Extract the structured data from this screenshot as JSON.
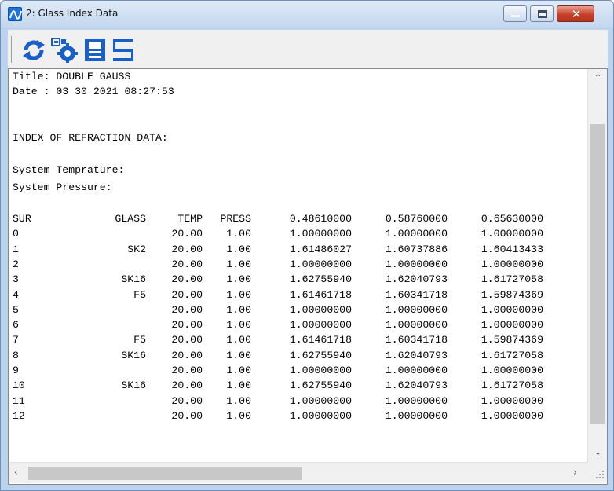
{
  "window": {
    "title": "2: Glass Index Data",
    "close_glyph": "✕"
  },
  "toolbar": {
    "buttons": [
      {
        "name": "refresh-icon"
      },
      {
        "name": "settings-icon"
      },
      {
        "name": "save-icon"
      },
      {
        "name": "print-icon"
      }
    ]
  },
  "report": {
    "title_line": "Title: DOUBLE GAUSS",
    "date_line": "Date : 03 30 2021 08:27:53",
    "section": "INDEX OF REFRACTION DATA:",
    "temperature_label": "System Temprature:",
    "pressure_label": "System Pressure:",
    "columns": [
      "SUR",
      "GLASS",
      "TEMP",
      "PRESS",
      "0.48610000",
      "0.58760000",
      "0.65630000"
    ],
    "rows": [
      [
        "0",
        "",
        "20.00",
        "1.00",
        "1.00000000",
        "1.00000000",
        "1.00000000"
      ],
      [
        "1",
        "SK2",
        "20.00",
        "1.00",
        "1.61486027",
        "1.60737886",
        "1.60413433"
      ],
      [
        "2",
        "",
        "20.00",
        "1.00",
        "1.00000000",
        "1.00000000",
        "1.00000000"
      ],
      [
        "3",
        "SK16",
        "20.00",
        "1.00",
        "1.62755940",
        "1.62040793",
        "1.61727058"
      ],
      [
        "4",
        "F5",
        "20.00",
        "1.00",
        "1.61461718",
        "1.60341718",
        "1.59874369"
      ],
      [
        "5",
        "",
        "20.00",
        "1.00",
        "1.00000000",
        "1.00000000",
        "1.00000000"
      ],
      [
        "6",
        "",
        "20.00",
        "1.00",
        "1.00000000",
        "1.00000000",
        "1.00000000"
      ],
      [
        "7",
        "F5",
        "20.00",
        "1.00",
        "1.61461718",
        "1.60341718",
        "1.59874369"
      ],
      [
        "8",
        "SK16",
        "20.00",
        "1.00",
        "1.62755940",
        "1.62040793",
        "1.61727058"
      ],
      [
        "9",
        "",
        "20.00",
        "1.00",
        "1.00000000",
        "1.00000000",
        "1.00000000"
      ],
      [
        "10",
        "SK16",
        "20.00",
        "1.00",
        "1.62755940",
        "1.62040793",
        "1.61727058"
      ],
      [
        "11",
        "",
        "20.00",
        "1.00",
        "1.00000000",
        "1.00000000",
        "1.00000000"
      ],
      [
        "12",
        "",
        "20.00",
        "1.00",
        "1.00000000",
        "1.00000000",
        "1.00000000"
      ]
    ]
  },
  "scrollbars": {
    "up_arrow": "⌃",
    "down_arrow": "⌄",
    "left_arrow": "‹",
    "right_arrow": "›"
  }
}
